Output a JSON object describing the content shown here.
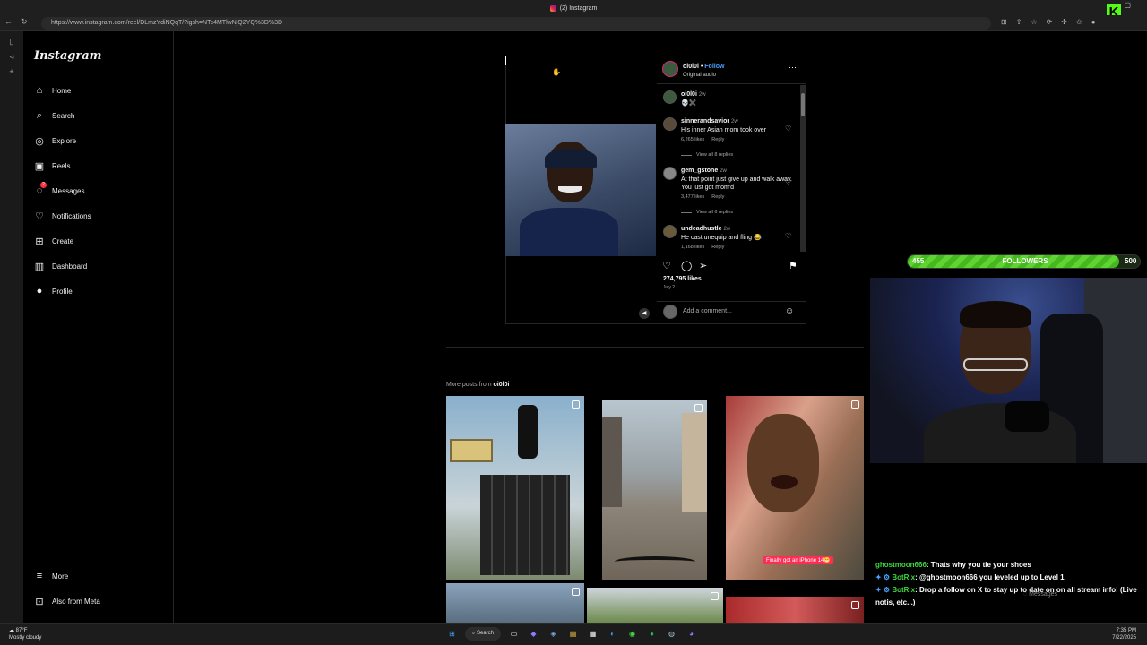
{
  "browser": {
    "tab_title": "(2) Instagram",
    "url": "https://www.instagram.com/reel/DLmzYdiNQqT/?igsh=NTc4MTlwNjQ2YQ%3D%3D"
  },
  "sidebar": {
    "logo": "Instagram",
    "items": [
      {
        "label": "Home",
        "icon": "home-icon"
      },
      {
        "label": "Search",
        "icon": "search-icon"
      },
      {
        "label": "Explore",
        "icon": "compass-icon"
      },
      {
        "label": "Reels",
        "icon": "reels-icon"
      },
      {
        "label": "Messages",
        "icon": "messenger-icon",
        "badge": "2"
      },
      {
        "label": "Notifications",
        "icon": "heart-icon"
      },
      {
        "label": "Create",
        "icon": "plus-square-icon"
      },
      {
        "label": "Dashboard",
        "icon": "dashboard-icon"
      },
      {
        "label": "Profile",
        "icon": "avatar-icon"
      }
    ],
    "bottom": [
      {
        "label": "More",
        "icon": "menu-icon"
      },
      {
        "label": "Also from Meta",
        "icon": "meta-icon"
      }
    ]
  },
  "post": {
    "author": "oi0l0i",
    "separator": "•",
    "follow": "Follow",
    "audio": "Original audio",
    "caption_user": "oi0l0i",
    "caption_time": "2w",
    "caption_text": "💀✖️",
    "comments": [
      {
        "user": "sinnerandsavior",
        "time": "2w",
        "text": "His inner Asian mom took over",
        "likes": "6,265 likes",
        "reply": "Reply",
        "replies": "View all 8 replies"
      },
      {
        "user": "gem_gstone",
        "time": "2w",
        "text": "At that point just give up and walk away. You just got mom'd",
        "likes": "3,477 likes",
        "reply": "Reply",
        "replies": "View all 6 replies"
      },
      {
        "user": "undeadhustle",
        "time": "2w",
        "text": "He cast unequip and fling 😂",
        "likes": "1,168 likes",
        "reply": "Reply"
      }
    ],
    "likes": "274,795 likes",
    "date": "July 2",
    "add_comment_placeholder": "Add a comment..."
  },
  "more_posts": {
    "label": "More posts from",
    "user": "oi0l0i",
    "tile3_caption": "Finally got an iPhone 14😁"
  },
  "overlay": {
    "followers_current": "455",
    "followers_label": "FOLLOWERS",
    "followers_goal": "500",
    "followers_progress": 0.91
  },
  "chat": [
    {
      "user": "ghostmoon666",
      "text": ": Thats why you tie your shoes"
    },
    {
      "user": "BotRix",
      "text": ": @ghostmoon666 you leveled up to Level 1"
    },
    {
      "user": "BotRix",
      "text": ": Drop a follow on X to stay up to date on on all stream info! (Live notis, etc...)"
    }
  ],
  "messages_popup": "Messages",
  "taskbar": {
    "temp": "87°F",
    "weather": "Mostly cloudy",
    "search": "Search",
    "time": "7:35 PM",
    "date": "7/22/2025"
  }
}
